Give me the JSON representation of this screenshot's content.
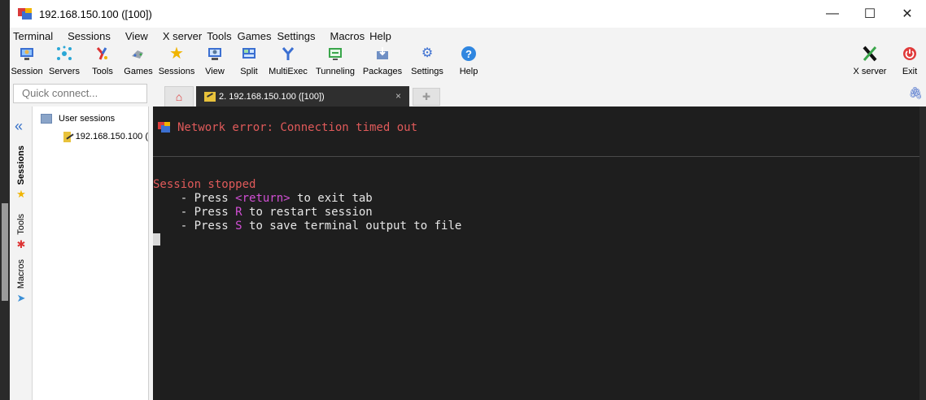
{
  "window": {
    "title": "192.168.150.100 ([100])",
    "controls": {
      "minimize": "—",
      "maximize": "☐",
      "close": "✕"
    }
  },
  "menubar": [
    "Terminal",
    "Sessions",
    "View",
    "X server",
    "Tools",
    "Games",
    "Settings",
    "Macros",
    "Help"
  ],
  "toolbar": {
    "left": [
      {
        "label": "Session",
        "icon": "session-icon"
      },
      {
        "label": "Servers",
        "icon": "servers-icon"
      },
      {
        "label": "Tools",
        "icon": "tools-icon"
      },
      {
        "label": "Games",
        "icon": "games-icon"
      },
      {
        "label": "Sessions",
        "icon": "star-icon"
      },
      {
        "label": "View",
        "icon": "view-icon"
      },
      {
        "label": "Split",
        "icon": "split-icon"
      },
      {
        "label": "MultiExec",
        "icon": "multiexec-icon"
      },
      {
        "label": "Tunneling",
        "icon": "tunneling-icon"
      },
      {
        "label": "Packages",
        "icon": "packages-icon"
      },
      {
        "label": "Settings",
        "icon": "gears-icon"
      },
      {
        "label": "Help",
        "icon": "help-icon"
      }
    ],
    "right": [
      {
        "label": "X server",
        "icon": "x-server-icon"
      },
      {
        "label": "Exit",
        "icon": "power-icon"
      }
    ]
  },
  "quick_connect": {
    "placeholder": "Quick connect..."
  },
  "tabs": {
    "active": {
      "label": "2. 192.168.150.100 ([100])",
      "close": "×"
    }
  },
  "sidebar": {
    "vertical_tabs": [
      "Sessions",
      "Tools",
      "Macros"
    ],
    "tree": {
      "root": "User sessions",
      "items": [
        "192.168.150.100 ("
      ]
    }
  },
  "terminal": {
    "error": "Network error: Connection timed out",
    "stopped": "Session stopped",
    "lines": [
      {
        "pre": "    - Press ",
        "key": "<return>",
        "post": " to exit tab"
      },
      {
        "pre": "    - Press ",
        "key": "R",
        "post": " to restart session"
      },
      {
        "pre": "    - Press ",
        "key": "S",
        "post": " to save terminal output to file"
      }
    ]
  },
  "colors": {
    "terminal_bg": "#1e1e1e",
    "error_red": "#e05a5a",
    "key_magenta": "#d14fd4"
  }
}
